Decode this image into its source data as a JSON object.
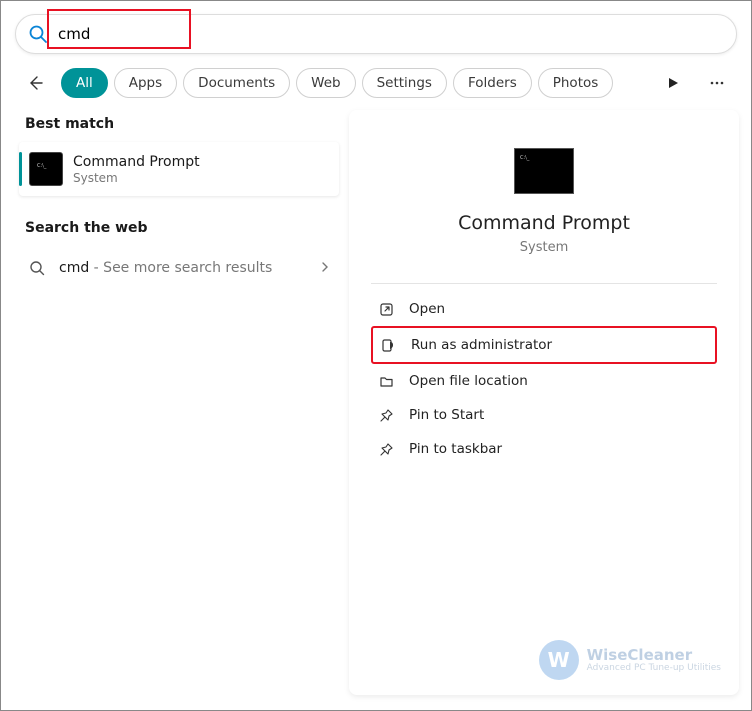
{
  "search": {
    "query": "cmd"
  },
  "filters": {
    "items": [
      {
        "label": "All",
        "active": true
      },
      {
        "label": "Apps",
        "active": false
      },
      {
        "label": "Documents",
        "active": false
      },
      {
        "label": "Web",
        "active": false
      },
      {
        "label": "Settings",
        "active": false
      },
      {
        "label": "Folders",
        "active": false
      },
      {
        "label": "Photos",
        "active": false
      }
    ]
  },
  "sections": {
    "best_match": "Best match",
    "search_web": "Search the web"
  },
  "best_result": {
    "title": "Command Prompt",
    "subtitle": "System"
  },
  "web_result": {
    "query": "cmd",
    "suffix": " - See more search results"
  },
  "detail": {
    "title": "Command Prompt",
    "subtitle": "System"
  },
  "actions": [
    {
      "icon": "open",
      "label": "Open",
      "hl": false
    },
    {
      "icon": "shield",
      "label": "Run as administrator",
      "hl": true
    },
    {
      "icon": "folder",
      "label": "Open file location",
      "hl": false
    },
    {
      "icon": "pin",
      "label": "Pin to Start",
      "hl": false
    },
    {
      "icon": "pin",
      "label": "Pin to taskbar",
      "hl": false
    }
  ],
  "watermark": {
    "brand": "WiseCleaner",
    "tagline": "Advanced PC Tune-up Utilities",
    "logo_letter": "W"
  }
}
